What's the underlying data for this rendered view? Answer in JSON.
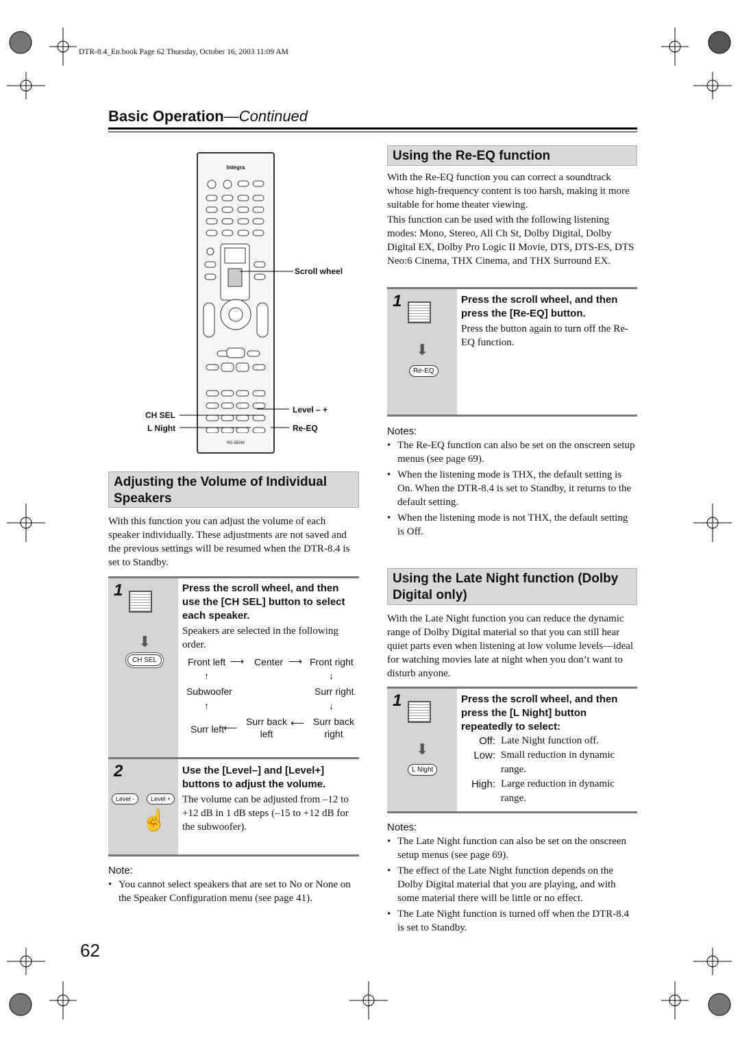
{
  "book_line": "DTR-8.4_En.book  Page 62  Thursday, October 16, 2003  11:09 AM",
  "header": {
    "title": "Basic Operation",
    "continued": "—Continued"
  },
  "remote": {
    "brand": "Integra",
    "model": "RC-550M",
    "callouts": {
      "scroll_wheel": "Scroll wheel",
      "ch_sel": "CH SEL",
      "l_night": "L Night",
      "level": "Level – +",
      "re_eq": "Re-EQ"
    }
  },
  "left": {
    "heading": "Adjusting the Volume of Individual Speakers",
    "intro": "With this function you can adjust the volume of each speaker individually. These adjustments are not saved and the previous settings will be resumed when the DTR-8.4 is set to Standby.",
    "step1": {
      "num": "1",
      "title": "Press the scroll wheel, and then use the [CH SEL] button to select each speaker.",
      "text": "Speakers are selected in the following order.",
      "button": "CH SEL",
      "order": {
        "front_left": "Front left",
        "center": "Center",
        "front_right": "Front right",
        "subwoofer": "Subwoofer",
        "surr_right": "Surr right",
        "surr_left": "Surr left",
        "surr_back_left": "Surr back left",
        "surr_back_right": "Surr back right"
      }
    },
    "step2": {
      "num": "2",
      "title": "Use the [Level–] and [Level+] buttons to adjust the volume.",
      "text": "The volume can be adjusted from –12 to +12 dB in 1 dB steps (–15 to +12 dB for the subwoofer).",
      "btn_minus": "Level -",
      "btn_plus": "Level +"
    },
    "note_heading": "Note:",
    "notes": [
      "You cannot select speakers that are set to No or None on the Speaker Configuration menu (see page 41)."
    ]
  },
  "right": {
    "reeq": {
      "heading": "Using the Re-EQ function",
      "p1": "With the Re-EQ function you can correct a soundtrack whose high-frequency content is too harsh, making it more suitable for home theater viewing.",
      "p2": "This function can be used with the following listening modes: Mono, Stereo, All Ch St, Dolby Digital, Dolby Digital EX, Dolby Pro Logic II Movie, DTS, DTS-ES, DTS Neo:6 Cinema, THX Cinema, and THX Surround EX.",
      "step": {
        "num": "1",
        "title": "Press the scroll wheel, and then press the [Re-EQ] button.",
        "text": "Press the button again to turn off the Re-EQ function.",
        "button": "Re-EQ"
      },
      "notes_heading": "Notes:",
      "notes": [
        "The Re-EQ function can also be set on the onscreen setup menus (see page 69).",
        "When the listening mode is THX, the default setting is On. When the DTR-8.4 is set to Standby, it returns to the default setting.",
        "When the listening mode is not THX, the default setting is Off."
      ]
    },
    "night": {
      "heading": "Using the Late Night function (Dolby Digital only)",
      "p1": "With the Late Night function you can reduce the dynamic range of Dolby Digital material so that you can still hear quiet parts even when listening at low volume levels—ideal for watching movies late at night when you don’t want to disturb anyone.",
      "step": {
        "num": "1",
        "title": "Press the scroll wheel, and then press the [L Night] button repeatedly to select:",
        "button": "L Night",
        "options": [
          {
            "k": "Off:",
            "v": "Late Night function off."
          },
          {
            "k": "Low:",
            "v": "Small reduction in dynamic range."
          },
          {
            "k": "High:",
            "v": "Large reduction in dynamic range."
          }
        ]
      },
      "notes_heading": "Notes:",
      "notes": [
        "The Late Night function can also be set on the onscreen setup menus (see page 69).",
        "The effect of the Late Night function depends on the Dolby Digital material that you are playing, and with some material there will be little or no effect.",
        "The Late Night function is turned off when the DTR-8.4 is set to Standby."
      ]
    }
  },
  "page_number": "62"
}
